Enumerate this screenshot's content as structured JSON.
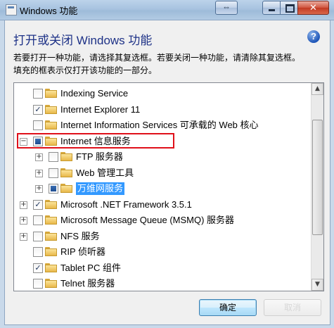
{
  "window": {
    "title": "Windows 功能"
  },
  "header": {
    "heading": "打开或关闭 Windows 功能",
    "description_line1": "若要打开一种功能，请选择其复选框。若要关闭一种功能，请清除其复选框。",
    "description_line2": "填充的框表示仅打开该功能的一部分。"
  },
  "tree": {
    "items": [
      {
        "label": "Indexing Service",
        "state": "unchecked",
        "expander": "none"
      },
      {
        "label": "Internet Explorer 11",
        "state": "checked",
        "expander": "none"
      },
      {
        "label": "Internet Information Services 可承载的 Web 核心",
        "state": "unchecked",
        "expander": "none"
      },
      {
        "label": "Internet 信息服务",
        "state": "partial",
        "expander": "collapse",
        "highlighted": true
      },
      {
        "label": "FTP 服务器",
        "state": "unchecked",
        "expander": "expand",
        "indent": 1
      },
      {
        "label": "Web 管理工具",
        "state": "unchecked",
        "expander": "expand",
        "indent": 1
      },
      {
        "label": "万维网服务",
        "state": "partial",
        "expander": "expand",
        "indent": 1,
        "selected": true
      },
      {
        "label": "Microsoft .NET Framework 3.5.1",
        "state": "checked",
        "expander": "expand"
      },
      {
        "label": "Microsoft Message Queue (MSMQ) 服务器",
        "state": "unchecked",
        "expander": "expand"
      },
      {
        "label": "NFS 服务",
        "state": "unchecked",
        "expander": "expand"
      },
      {
        "label": "RIP 侦听器",
        "state": "unchecked",
        "expander": "none"
      },
      {
        "label": "Tablet PC 组件",
        "state": "checked",
        "expander": "none"
      },
      {
        "label": "Telnet 服务器",
        "state": "unchecked",
        "expander": "none"
      }
    ]
  },
  "buttons": {
    "ok": "确定",
    "cancel": "取消"
  },
  "colors": {
    "highlight_box": "#e0101a",
    "selection": "#3399ff",
    "heading": "#1e3287"
  }
}
